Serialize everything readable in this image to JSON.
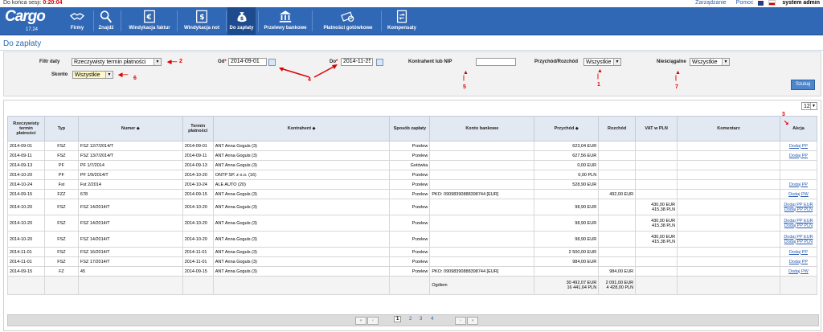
{
  "session": {
    "label": "Do końca sesji:",
    "time": "0:20:04"
  },
  "toplinks": {
    "manage": "Zarządzanie",
    "help": "Pomoc",
    "user": "system admin"
  },
  "app": {
    "logo": "Cargo",
    "version": "17.24"
  },
  "nav": [
    {
      "label": "Firmy",
      "icon": "handshake-icon"
    },
    {
      "label": "Znajdź",
      "icon": "magnifier-icon"
    },
    {
      "label": "Windykacja faktur",
      "icon": "euro-invoice-icon"
    },
    {
      "label": "Windykacja not",
      "icon": "note-dollar-icon"
    },
    {
      "label": "Do zapłaty",
      "icon": "money-bag-icon"
    },
    {
      "label": "Przelewy bankowe",
      "icon": "bank-icon"
    },
    {
      "label": "Płatności gotówkowe",
      "icon": "cash-icon"
    },
    {
      "label": "Kompensaty",
      "icon": "compensation-icon"
    }
  ],
  "page": {
    "title": "Do zapłaty"
  },
  "filters": {
    "date_filter_label": "Filtr daty",
    "date_filter_value": "Rzeczywisty termin płatności",
    "from_label": "Od",
    "from_value": "2014-09-01",
    "to_label": "Do",
    "to_value": "2014-11-25",
    "contractor_label": "Kontrahent lub NIP",
    "contractor_value": "",
    "income_label": "Przychód/Rozchód",
    "income_value": "Wszystkie",
    "uncollectable_label": "Nieściągalne",
    "uncollectable_value": "Wszystkie",
    "discount_label": "Skonto",
    "discount_value": "Wszystkie",
    "search_button": "Szukaj"
  },
  "annotations": [
    "1",
    "2",
    "3",
    "4",
    "5",
    "6",
    "7"
  ],
  "page_size": "12",
  "table": {
    "headers": [
      "Rzeczywisty termin płatności",
      "Typ",
      "Numer",
      "Termin płatności",
      "Kontrahent",
      "Sposób zapłaty",
      "Konto bankowe",
      "Przychód",
      "Rozchód",
      "VAT w PLN",
      "Komentarz",
      "Akcja"
    ],
    "rows": [
      {
        "date": "2014-09-01",
        "type": "FSZ",
        "number": "FSZ 12/7/2014/T",
        "due": "2014-09-01",
        "contractor": "ANT Anna Goguls (3)",
        "method": "Przelew",
        "account": "",
        "income": "623,04 EUR",
        "expense": "",
        "vat": "",
        "vat2": "",
        "comment": "",
        "action": "Dodaj PP",
        "action2": ""
      },
      {
        "date": "2014-09-11",
        "type": "FSZ",
        "number": "FSZ 13/7/2014/T",
        "due": "2014-09-11",
        "contractor": "ANT Anna Goguls (3)",
        "method": "Przelew",
        "account": "",
        "income": "627,56 EUR",
        "expense": "",
        "vat": "",
        "vat2": "",
        "comment": "",
        "action": "Dodaj PP",
        "action2": ""
      },
      {
        "date": "2014-09-13",
        "type": "PF",
        "number": "PF 1/7/2014",
        "due": "2014-09-13",
        "contractor": "ANT Anna Goguls (3)",
        "method": "Gotówka",
        "account": "",
        "income": "0,00 EUR",
        "expense": "",
        "vat": "",
        "vat2": "",
        "comment": "",
        "action": "",
        "action2": ""
      },
      {
        "date": "2014-10-20",
        "type": "PF",
        "number": "PF 1/9/2014/T",
        "due": "2014-10-20",
        "contractor": "ONTP SP. z o.o. (16)",
        "method": "Przelew",
        "account": "",
        "income": "0,00 PLN",
        "expense": "",
        "vat": "",
        "vat2": "",
        "comment": "",
        "action": "",
        "action2": ""
      },
      {
        "date": "2014-10-24",
        "type": "Fst",
        "number": "Fst 2/2014",
        "due": "2014-10-24",
        "contractor": "ALE AUTO (20)",
        "method": "Przelew",
        "account": "",
        "income": "528,90 EUR",
        "expense": "",
        "vat": "",
        "vat2": "",
        "comment": "",
        "action": "Dodaj PP",
        "action2": ""
      },
      {
        "date": "2014-09-15",
        "type": "FZZ",
        "number": "678",
        "due": "2014-09-15",
        "contractor": "ANT Anna Goguls (3)",
        "method": "Przelew",
        "account": "PKO: 09098390888398744 [EUR]",
        "income": "",
        "expense": "492,00 EUR",
        "vat": "",
        "vat2": "",
        "comment": "",
        "action": "Dodaj PW",
        "action2": ""
      },
      {
        "date": "2014-10-20",
        "type": "FSZ",
        "number": "FSZ 14/2014/T",
        "due": "2014-10-20",
        "contractor": "ANT Anna Goguls (3)",
        "method": "Przelew",
        "account": "",
        "income": "98,90 EUR",
        "expense": "",
        "vat": "430,00 EUR",
        "vat2": "415,38 PLN",
        "comment": "",
        "action": "Dodaj PP EUR",
        "action2": "Dodaj PP PLN"
      },
      {
        "date": "2014-10-20",
        "type": "FSZ",
        "number": "FSZ 14/2014/T",
        "due": "2014-10-20",
        "contractor": "ANT Anna Goguls (3)",
        "method": "Przelew",
        "account": "",
        "income": "98,90 EUR",
        "expense": "",
        "vat": "430,00 EUR",
        "vat2": "415,38 PLN",
        "comment": "",
        "action": "Dodaj PP EUR",
        "action2": "Dodaj PP PLN"
      },
      {
        "date": "2014-10-20",
        "type": "FSZ",
        "number": "FSZ 14/2014/T",
        "due": "2014-10-20",
        "contractor": "ANT Anna Goguls (3)",
        "method": "Przelew",
        "account": "",
        "income": "98,90 EUR",
        "expense": "",
        "vat": "430,00 EUR",
        "vat2": "415,38 PLN",
        "comment": "",
        "action": "Dodaj PP EUR",
        "action2": "Dodaj PP PLN"
      },
      {
        "date": "2014-11-01",
        "type": "FSZ",
        "number": "FSZ 16/2014/T",
        "due": "2014-11-01",
        "contractor": "ANT Anna Goguls (3)",
        "method": "Przelew",
        "account": "",
        "income": "2 500,00 EUR",
        "expense": "",
        "vat": "",
        "vat2": "",
        "comment": "",
        "action": "Dodaj PP",
        "action2": ""
      },
      {
        "date": "2014-11-01",
        "type": "FSZ",
        "number": "FSZ 17/2014/T",
        "due": "2014-11-01",
        "contractor": "ANT Anna Goguls (3)",
        "method": "Przelew",
        "account": "",
        "income": "984,00 EUR",
        "expense": "",
        "vat": "",
        "vat2": "",
        "comment": "",
        "action": "Dodaj PP",
        "action2": ""
      },
      {
        "date": "2014-09-15",
        "type": "FZ",
        "number": "45",
        "due": "2014-09-15",
        "contractor": "ANT Anna Goguls (3)",
        "method": "Przelew",
        "account": "PKO: 09098390888398744 [EUR]",
        "income": "",
        "expense": "984,00 EUR",
        "vat": "",
        "vat2": "",
        "comment": "",
        "action": "Dodaj PW",
        "action2": ""
      }
    ],
    "summary": {
      "label": "Ogółem",
      "income1": "30 492,07 EUR",
      "income2": "16 441,64 PLN",
      "expense1": "2 091,00 EUR",
      "expense2": "4 428,00 PLN"
    }
  },
  "pager": {
    "first": "«",
    "prev": "‹",
    "pages": [
      "1",
      "2",
      "3",
      "4"
    ],
    "next": "›",
    "last": "»"
  },
  "colors": {
    "nav": "#3168b5",
    "accent": "#2a5db0",
    "annotation": "#d00000"
  }
}
